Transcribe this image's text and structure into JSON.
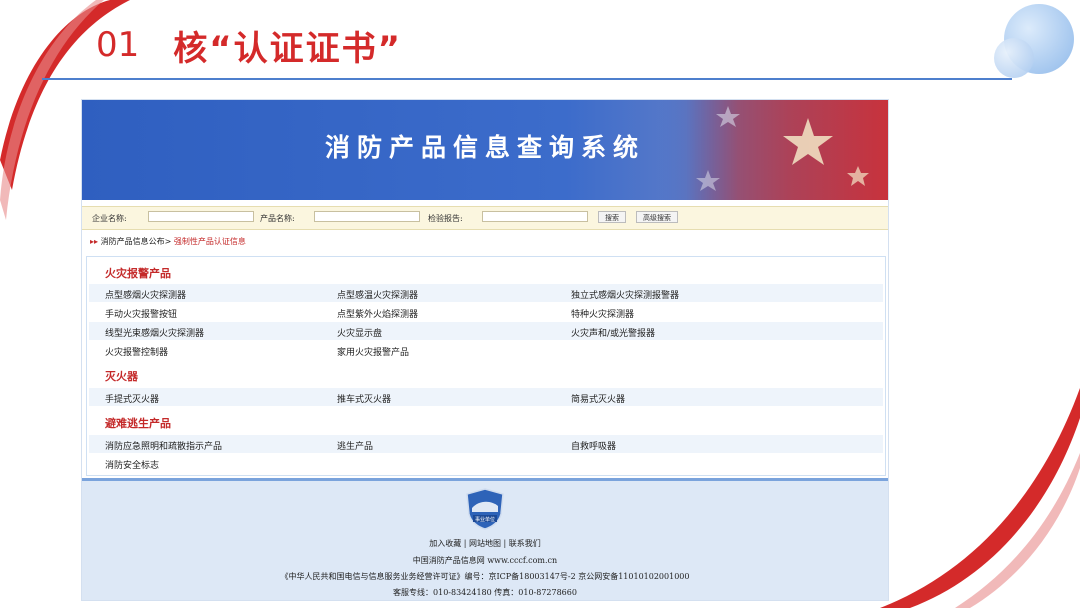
{
  "slide": {
    "number": "01",
    "title": "核“认证证书”"
  },
  "site": {
    "banner_title": "消防产品信息查询系统",
    "search": {
      "company_label": "企业名称:",
      "product_label": "产品名称:",
      "report_label": "检验报告:",
      "company_value": "",
      "product_value": "",
      "report_value": "",
      "search_button": "搜索",
      "advanced_button": "高级搜索"
    },
    "breadcrumb": {
      "arrow": "▸▸",
      "parent": "消防产品信息公布>",
      "current": "强制性产品认证信息"
    },
    "categories": [
      {
        "name": "火灾报警产品",
        "items": [
          "点型感烟火灾探测器",
          "点型感温火灾探测器",
          "独立式感烟火灾探测报警器",
          "手动火灾报警按钮",
          "点型紫外火焰探测器",
          "特种火灾探测器",
          "线型光束感烟火灾探测器",
          "火灾显示盘",
          "火灾声和/或光警报器",
          "火灾报警控制器",
          "家用火灾报警产品"
        ]
      },
      {
        "name": "灭火器",
        "items": [
          "手提式灭火器",
          "推车式灭火器",
          "简易式灭火器"
        ]
      },
      {
        "name": "避难逃生产品",
        "items": [
          "消防应急照明和疏散指示产品",
          "逃生产品",
          "自救呼吸器",
          "消防安全标志"
        ]
      }
    ],
    "footer": {
      "logo_text": "事业单位",
      "links": [
        "加入收藏",
        "网站地图",
        "联系我们"
      ],
      "separator": "|",
      "site_line": "中国消防产品信息网 www.cccf.com.cn",
      "license_line": "《中华人民共和国电信与信息服务业务经营许可证》编号：京ICP备18003147号-2 京公网安备11010102001000",
      "contact_line": "客服专线：010-83424180 传真：010-87278660"
    }
  },
  "colors": {
    "accent_red": "#d42a2a",
    "banner_blue": "#3563c4",
    "rule_blue": "#4e7fcd"
  }
}
